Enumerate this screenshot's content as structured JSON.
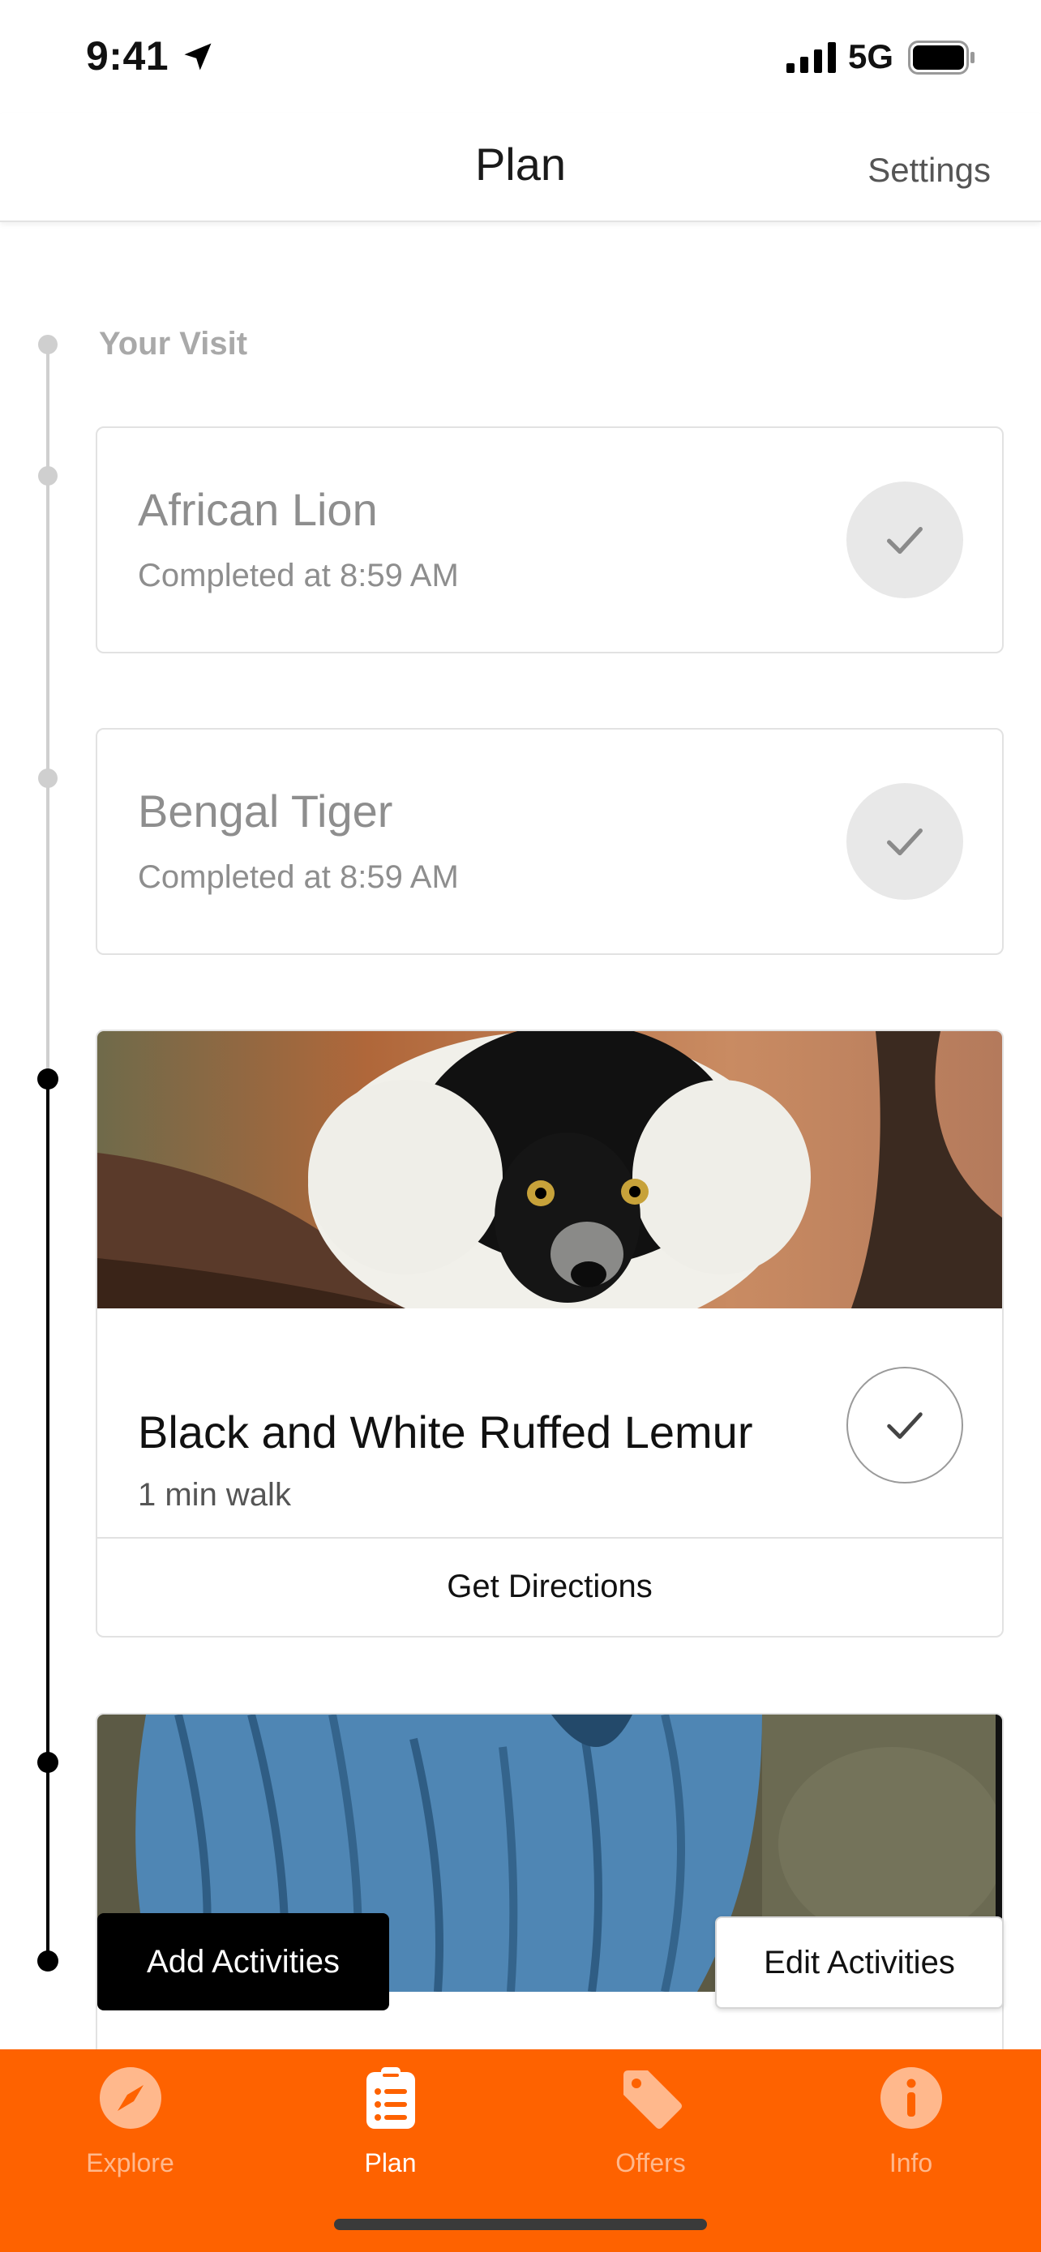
{
  "status_bar": {
    "time": "9:41",
    "network": "5G"
  },
  "nav": {
    "title": "Plan",
    "settings_label": "Settings"
  },
  "timeline": {
    "section_label": "Your Visit",
    "completed": [
      {
        "title": "African Lion",
        "subtitle": "Completed at 8:59 AM"
      },
      {
        "title": "Bengal Tiger",
        "subtitle": "Completed at 8:59 AM"
      }
    ],
    "current": {
      "title": "Black and White Ruffed Lemur",
      "subtitle": "1 min walk",
      "directions_label": "Get Directions"
    }
  },
  "actions": {
    "add_label": "Add Activities",
    "edit_label": "Edit Activities"
  },
  "tab_bar": {
    "tabs": [
      {
        "label": "Explore",
        "icon": "compass-icon",
        "active": false
      },
      {
        "label": "Plan",
        "icon": "clipboard-list-icon",
        "active": true
      },
      {
        "label": "Offers",
        "icon": "tag-icon",
        "active": false
      },
      {
        "label": "Info",
        "icon": "info-icon",
        "active": false
      }
    ]
  },
  "colors": {
    "brand_orange": "#fe6200",
    "completed_gray": "#8e8e8e",
    "timeline_gray": "#cfcfcf"
  }
}
